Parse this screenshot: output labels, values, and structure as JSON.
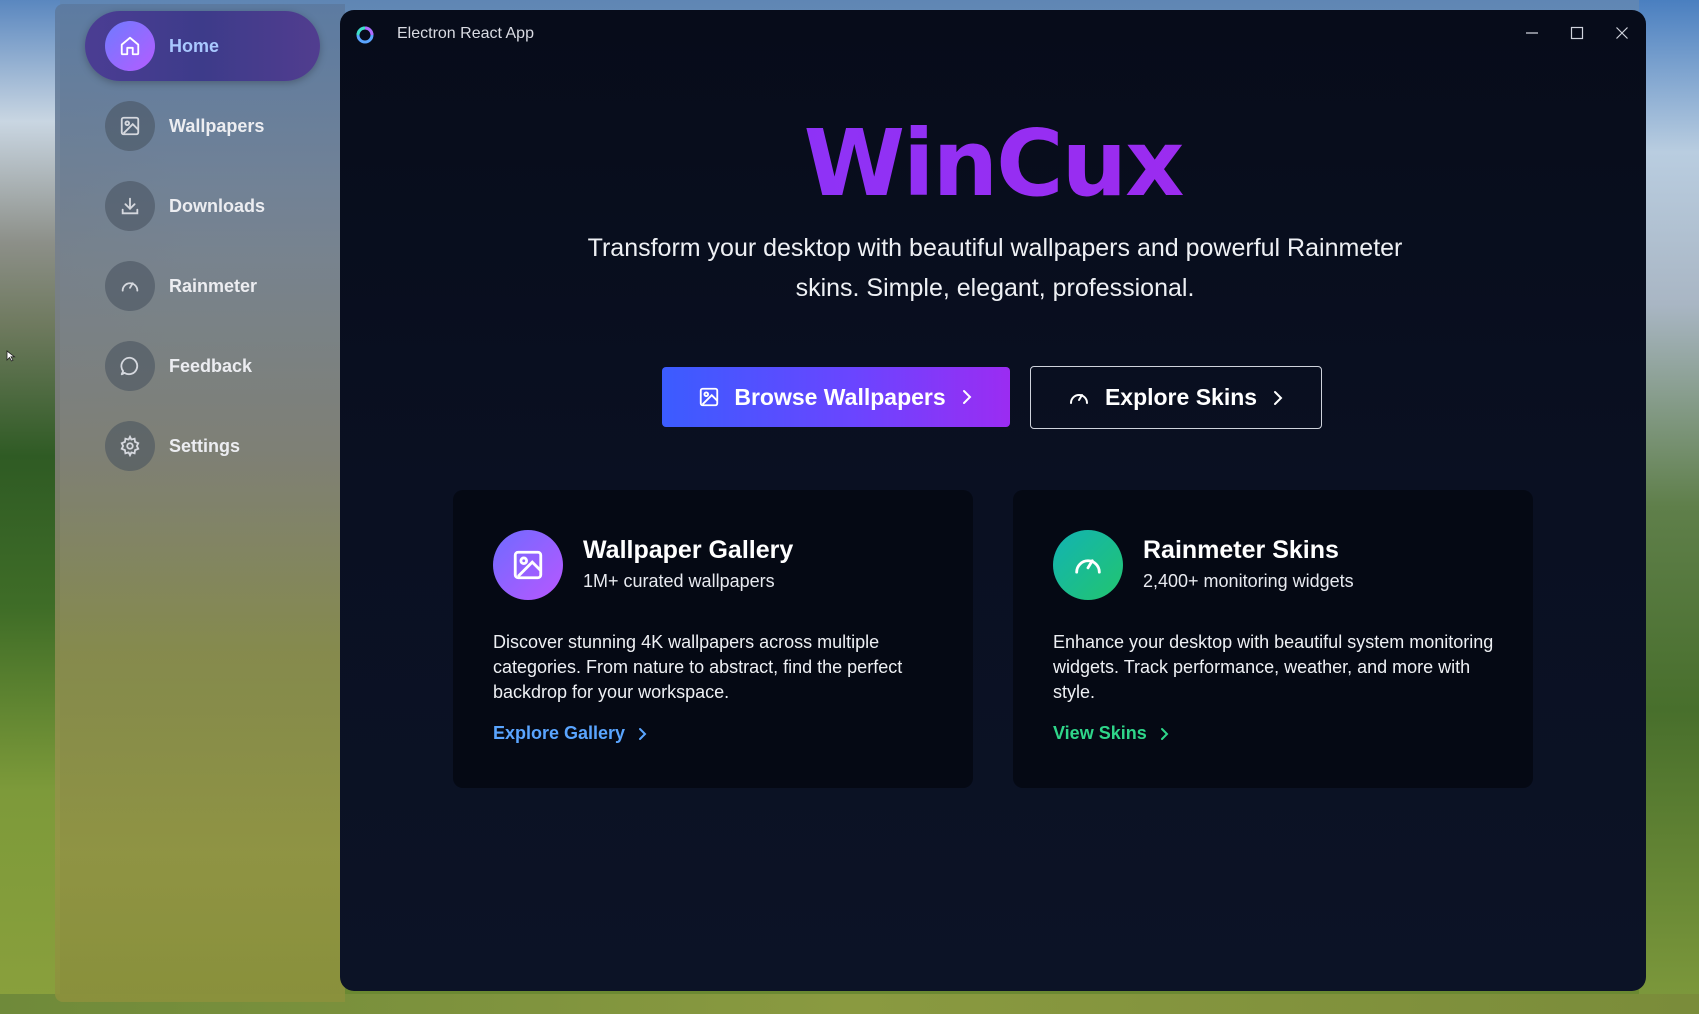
{
  "window": {
    "title": "Electron React App",
    "controls": {
      "minimize": "minimize-icon",
      "maximize": "maximize-icon",
      "close": "close-icon"
    }
  },
  "sidebar": {
    "items": [
      {
        "label": "Home",
        "icon": "home-icon",
        "active": true
      },
      {
        "label": "Wallpapers",
        "icon": "image-icon",
        "active": false
      },
      {
        "label": "Downloads",
        "icon": "download-icon",
        "active": false
      },
      {
        "label": "Rainmeter",
        "icon": "gauge-icon",
        "active": false
      },
      {
        "label": "Feedback",
        "icon": "chat-bubble-icon",
        "active": false
      },
      {
        "label": "Settings",
        "icon": "gear-icon",
        "active": false
      }
    ]
  },
  "hero": {
    "title": "WinCux",
    "subtitle": "Transform your desktop with beautiful wallpapers and powerful Rainmeter skins. Simple, elegant, professional."
  },
  "actions": {
    "primary_label": "Browse Wallpapers",
    "secondary_label": "Explore Skins"
  },
  "cards": [
    {
      "title": "Wallpaper Gallery",
      "subtitle": "1M+ curated wallpapers",
      "description": "Discover stunning 4K wallpapers across multiple categories. From nature to abstract, find the perfect backdrop for your workspace.",
      "link": "Explore Gallery",
      "accent": "#5aa5ff"
    },
    {
      "title": "Rainmeter Skins",
      "subtitle": "2,400+ monitoring widgets",
      "description": "Enhance your desktop with beautiful system monitoring widgets. Track performance, weather, and more with style.",
      "link": "View Skins",
      "accent": "#2fd68a"
    }
  ],
  "colors": {
    "brand_gradient_start": "#7d3cff",
    "brand_gradient_end": "#a32ce8",
    "window_bg": "#070c1a"
  }
}
